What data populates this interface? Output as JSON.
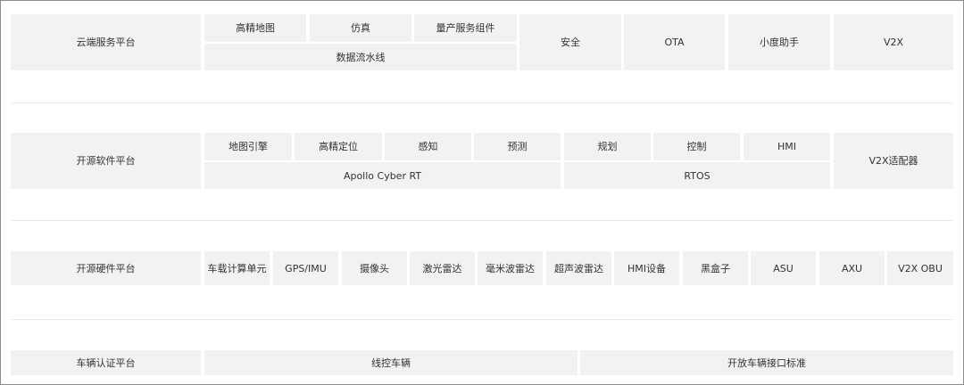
{
  "cloud_platform": {
    "label": "云端服务平台",
    "hd_map": "高精地图",
    "simulation": "仿真",
    "mass_production": "量产服务组件",
    "data_pipeline": "数据流水线",
    "security": "安全",
    "ota": "OTA",
    "xiaodu": "小度助手",
    "v2x": "V2X"
  },
  "software_platform": {
    "label": "开源软件平台",
    "map_engine": "地图引擎",
    "hd_localization": "高精定位",
    "perception": "感知",
    "prediction": "预测",
    "planning": "规划",
    "control": "控制",
    "hmi": "HMI",
    "cyber_rt": "Apollo Cyber RT",
    "rtos": "RTOS",
    "v2x_adapter": "V2X适配器"
  },
  "hardware_platform": {
    "label": "开源硬件平台",
    "items": [
      "车载计算单元",
      "GPS/IMU",
      "摄像头",
      "激光雷达",
      "毫米波雷达",
      "超声波雷达",
      "HMI设备",
      "黑盒子",
      "ASU",
      "AXU",
      "V2X OBU"
    ]
  },
  "vehicle_platform": {
    "label": "车辆认证平台",
    "drive_by_wire": "线控车辆",
    "open_interface": "开放车辆接口标准"
  }
}
